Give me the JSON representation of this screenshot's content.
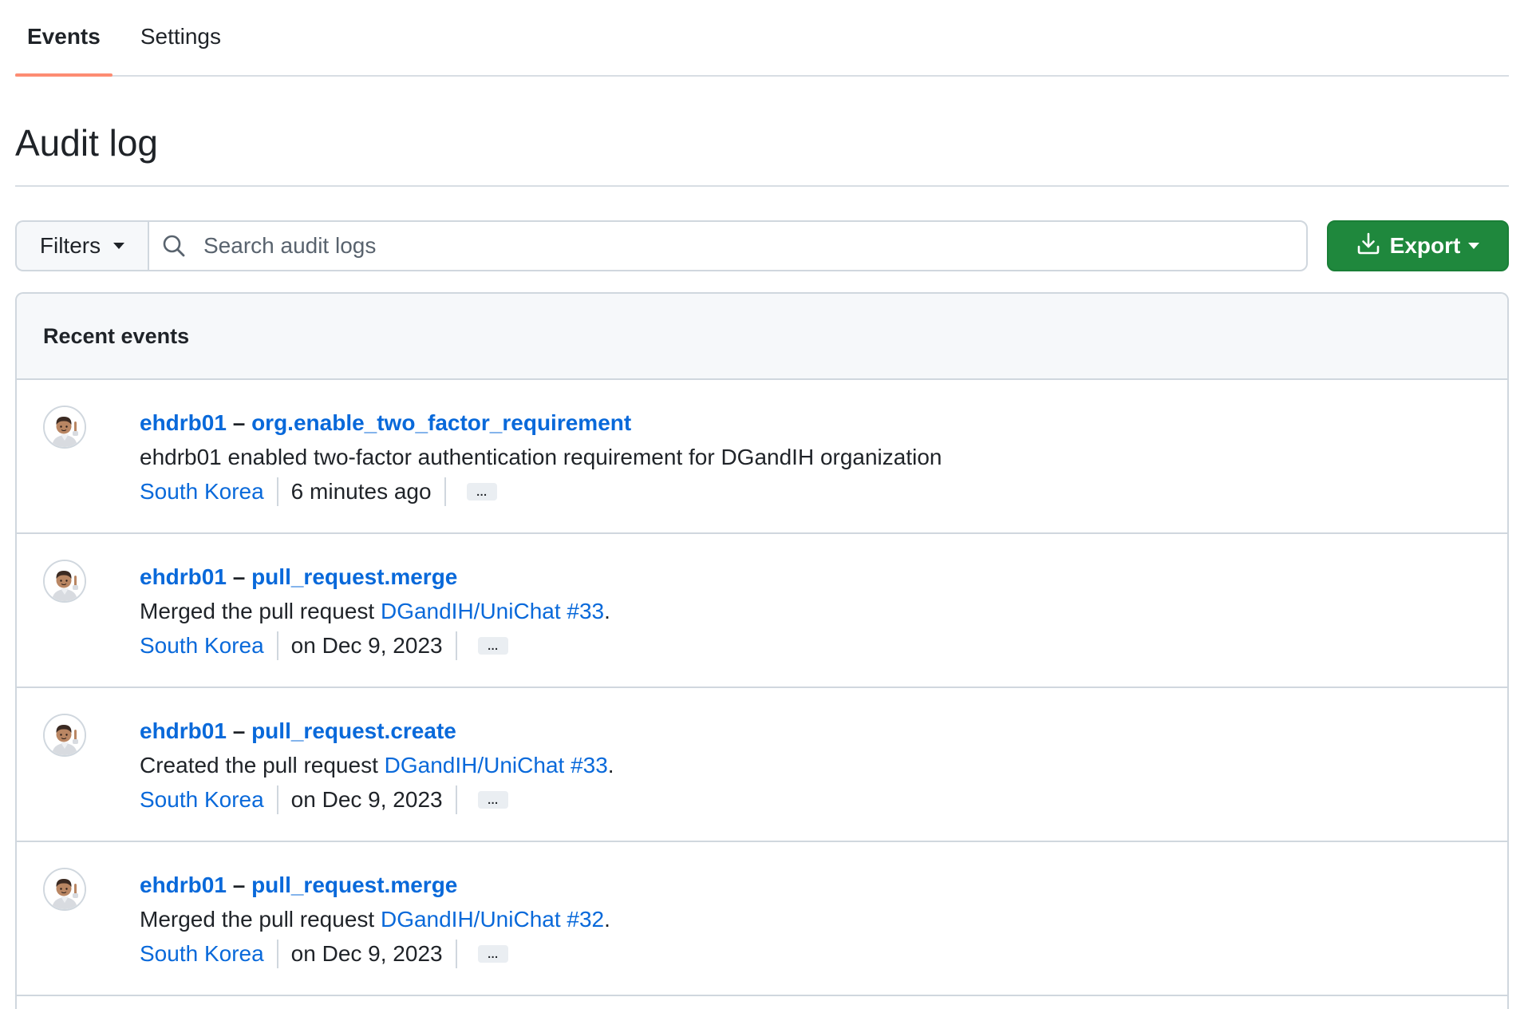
{
  "tabs": [
    {
      "label": "Events",
      "active": true
    },
    {
      "label": "Settings",
      "active": false
    }
  ],
  "page_title": "Audit log",
  "filters": {
    "label": "Filters",
    "icon": "triangle-down-icon"
  },
  "search": {
    "placeholder": "Search audit logs",
    "value": "",
    "icon": "search-icon"
  },
  "export": {
    "label": "Export",
    "icon": "download-icon"
  },
  "events_header": "Recent events",
  "colors": {
    "accent": "#0969da",
    "export_bg": "#1f883d",
    "tab_underline": "#fd8c73"
  },
  "events": [
    {
      "actor": "ehdrb01",
      "separator": "–",
      "action": "org.enable_two_factor_requirement",
      "desc_prefix": "ehdrb01 enabled two-factor authentication requirement for DGandIH organization",
      "desc_link": "",
      "desc_suffix": "",
      "location": "South Korea",
      "time": "6 minutes ago",
      "more": "…"
    },
    {
      "actor": "ehdrb01",
      "separator": "–",
      "action": "pull_request.merge",
      "desc_prefix": "Merged the pull request ",
      "desc_link": "DGandIH/UniChat #33",
      "desc_suffix": ".",
      "location": "South Korea",
      "time": "on Dec 9, 2023",
      "more": "…"
    },
    {
      "actor": "ehdrb01",
      "separator": "–",
      "action": "pull_request.create",
      "desc_prefix": "Created the pull request ",
      "desc_link": "DGandIH/UniChat #33",
      "desc_suffix": ".",
      "location": "South Korea",
      "time": "on Dec 9, 2023",
      "more": "…"
    },
    {
      "actor": "ehdrb01",
      "separator": "–",
      "action": "pull_request.merge",
      "desc_prefix": "Merged the pull request ",
      "desc_link": "DGandIH/UniChat #32",
      "desc_suffix": ".",
      "location": "South Korea",
      "time": "on Dec 9, 2023",
      "more": "…"
    }
  ]
}
